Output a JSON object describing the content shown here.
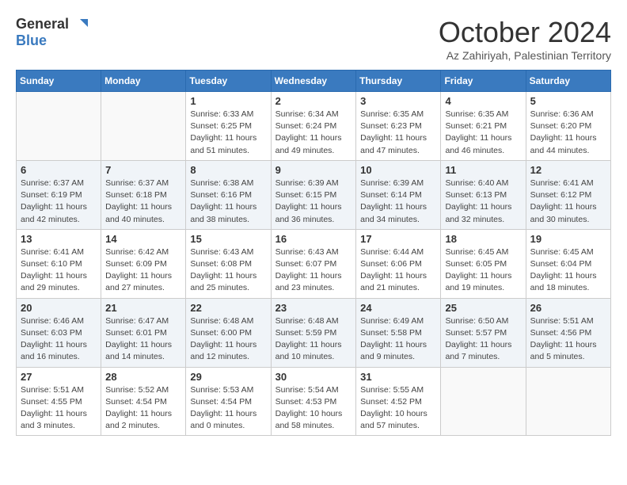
{
  "logo": {
    "general": "General",
    "blue": "Blue"
  },
  "title": "October 2024",
  "location": "Az Zahiriyah, Palestinian Territory",
  "days_of_week": [
    "Sunday",
    "Monday",
    "Tuesday",
    "Wednesday",
    "Thursday",
    "Friday",
    "Saturday"
  ],
  "weeks": [
    [
      {
        "day": "",
        "info": ""
      },
      {
        "day": "",
        "info": ""
      },
      {
        "day": "1",
        "info": "Sunrise: 6:33 AM\nSunset: 6:25 PM\nDaylight: 11 hours and 51 minutes."
      },
      {
        "day": "2",
        "info": "Sunrise: 6:34 AM\nSunset: 6:24 PM\nDaylight: 11 hours and 49 minutes."
      },
      {
        "day": "3",
        "info": "Sunrise: 6:35 AM\nSunset: 6:23 PM\nDaylight: 11 hours and 47 minutes."
      },
      {
        "day": "4",
        "info": "Sunrise: 6:35 AM\nSunset: 6:21 PM\nDaylight: 11 hours and 46 minutes."
      },
      {
        "day": "5",
        "info": "Sunrise: 6:36 AM\nSunset: 6:20 PM\nDaylight: 11 hours and 44 minutes."
      }
    ],
    [
      {
        "day": "6",
        "info": "Sunrise: 6:37 AM\nSunset: 6:19 PM\nDaylight: 11 hours and 42 minutes."
      },
      {
        "day": "7",
        "info": "Sunrise: 6:37 AM\nSunset: 6:18 PM\nDaylight: 11 hours and 40 minutes."
      },
      {
        "day": "8",
        "info": "Sunrise: 6:38 AM\nSunset: 6:16 PM\nDaylight: 11 hours and 38 minutes."
      },
      {
        "day": "9",
        "info": "Sunrise: 6:39 AM\nSunset: 6:15 PM\nDaylight: 11 hours and 36 minutes."
      },
      {
        "day": "10",
        "info": "Sunrise: 6:39 AM\nSunset: 6:14 PM\nDaylight: 11 hours and 34 minutes."
      },
      {
        "day": "11",
        "info": "Sunrise: 6:40 AM\nSunset: 6:13 PM\nDaylight: 11 hours and 32 minutes."
      },
      {
        "day": "12",
        "info": "Sunrise: 6:41 AM\nSunset: 6:12 PM\nDaylight: 11 hours and 30 minutes."
      }
    ],
    [
      {
        "day": "13",
        "info": "Sunrise: 6:41 AM\nSunset: 6:10 PM\nDaylight: 11 hours and 29 minutes."
      },
      {
        "day": "14",
        "info": "Sunrise: 6:42 AM\nSunset: 6:09 PM\nDaylight: 11 hours and 27 minutes."
      },
      {
        "day": "15",
        "info": "Sunrise: 6:43 AM\nSunset: 6:08 PM\nDaylight: 11 hours and 25 minutes."
      },
      {
        "day": "16",
        "info": "Sunrise: 6:43 AM\nSunset: 6:07 PM\nDaylight: 11 hours and 23 minutes."
      },
      {
        "day": "17",
        "info": "Sunrise: 6:44 AM\nSunset: 6:06 PM\nDaylight: 11 hours and 21 minutes."
      },
      {
        "day": "18",
        "info": "Sunrise: 6:45 AM\nSunset: 6:05 PM\nDaylight: 11 hours and 19 minutes."
      },
      {
        "day": "19",
        "info": "Sunrise: 6:45 AM\nSunset: 6:04 PM\nDaylight: 11 hours and 18 minutes."
      }
    ],
    [
      {
        "day": "20",
        "info": "Sunrise: 6:46 AM\nSunset: 6:03 PM\nDaylight: 11 hours and 16 minutes."
      },
      {
        "day": "21",
        "info": "Sunrise: 6:47 AM\nSunset: 6:01 PM\nDaylight: 11 hours and 14 minutes."
      },
      {
        "day": "22",
        "info": "Sunrise: 6:48 AM\nSunset: 6:00 PM\nDaylight: 11 hours and 12 minutes."
      },
      {
        "day": "23",
        "info": "Sunrise: 6:48 AM\nSunset: 5:59 PM\nDaylight: 11 hours and 10 minutes."
      },
      {
        "day": "24",
        "info": "Sunrise: 6:49 AM\nSunset: 5:58 PM\nDaylight: 11 hours and 9 minutes."
      },
      {
        "day": "25",
        "info": "Sunrise: 6:50 AM\nSunset: 5:57 PM\nDaylight: 11 hours and 7 minutes."
      },
      {
        "day": "26",
        "info": "Sunrise: 5:51 AM\nSunset: 4:56 PM\nDaylight: 11 hours and 5 minutes."
      }
    ],
    [
      {
        "day": "27",
        "info": "Sunrise: 5:51 AM\nSunset: 4:55 PM\nDaylight: 11 hours and 3 minutes."
      },
      {
        "day": "28",
        "info": "Sunrise: 5:52 AM\nSunset: 4:54 PM\nDaylight: 11 hours and 2 minutes."
      },
      {
        "day": "29",
        "info": "Sunrise: 5:53 AM\nSunset: 4:54 PM\nDaylight: 11 hours and 0 minutes."
      },
      {
        "day": "30",
        "info": "Sunrise: 5:54 AM\nSunset: 4:53 PM\nDaylight: 10 hours and 58 minutes."
      },
      {
        "day": "31",
        "info": "Sunrise: 5:55 AM\nSunset: 4:52 PM\nDaylight: 10 hours and 57 minutes."
      },
      {
        "day": "",
        "info": ""
      },
      {
        "day": "",
        "info": ""
      }
    ]
  ]
}
